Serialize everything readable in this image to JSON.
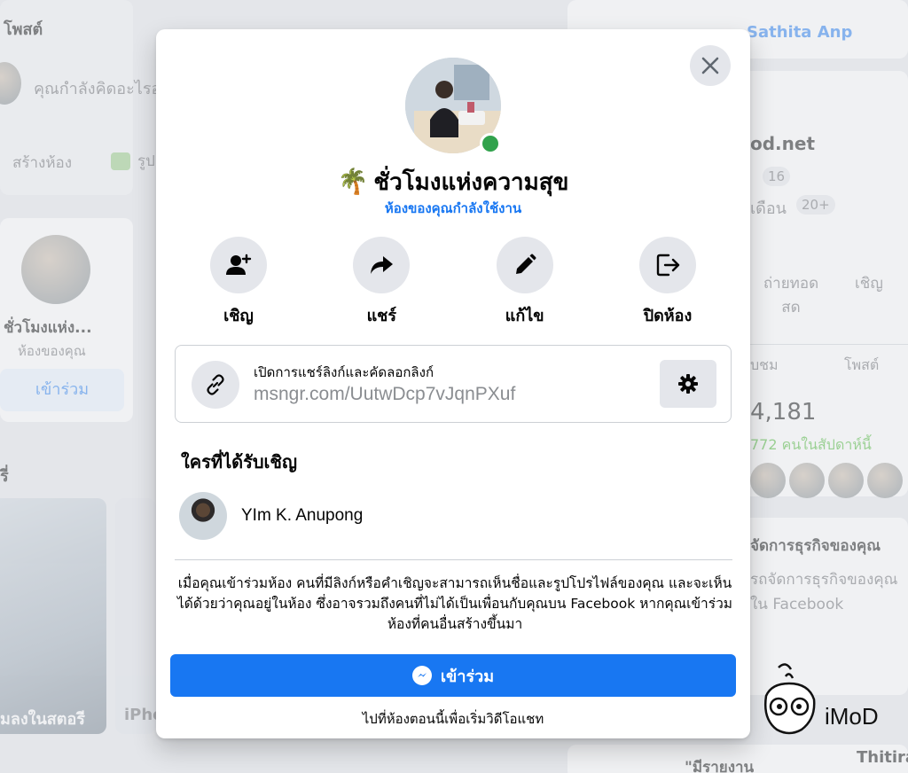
{
  "background": {
    "left_title": "โพสต์",
    "composer_placeholder": "คุณกำลังคิดอะไรอยู่",
    "create_room": "สร้างห้อง",
    "photo_chip": "รูป",
    "room_card_title": "ชั่วโมงแห่ง...",
    "room_card_sub": "ห้องของคุณ",
    "room_card_join": "เข้าร่วม",
    "stories_title": "รี่",
    "story_caption": "มลงในสตอรี",
    "story_caption2": "iPho",
    "right_header": "Sathita Anp",
    "site_name": "od.net",
    "count_chip_1": "16",
    "month_label": "เดือน",
    "count_chip_2": "20+",
    "live_label": "ถ่ายทอดสด",
    "invite_label_bg": "เชิญ",
    "tab_likes": "บชม",
    "tab_posts": "โพสต์",
    "likes_count": "4,181",
    "likes_week": "772 คนในสัปดาห์นี้",
    "promo_title": "จัดการธุรกิจของคุณ",
    "promo_text": "รถจัดการธุรกิจของคุณใน Facebook",
    "bottom_quote": "\"มีรายงาน",
    "bottom_name": "Thitira"
  },
  "modal": {
    "room_emoji": "🌴",
    "room_title": "ชั่วโมงแห่งความสุข",
    "room_subtitle": "ห้องของคุณกำลังใช้งาน",
    "actions": [
      {
        "label": "เชิญ",
        "icon": "add-person-icon"
      },
      {
        "label": "แชร์",
        "icon": "share-arrow-icon"
      },
      {
        "label": "แก้ไข",
        "icon": "pencil-icon"
      },
      {
        "label": "ปิดห้อง",
        "icon": "exit-icon"
      }
    ],
    "link_label": "เปิดการแชร์ลิงก์และคัดลอกลิงก์",
    "link_url": "msngr.com/UutwDcp7vJqnPXuf",
    "invited_title": "ใครที่ได้รับเชิญ",
    "invitees": [
      {
        "name": "YIm K. Anupong"
      }
    ],
    "notice": "เมื่อคุณเข้าร่วมห้อง คนที่มีลิงก์หรือคำเชิญจะสามารถเห็นชื่อและรูปโปรไฟล์ของคุณ และจะเห็นได้ด้วยว่าคุณอยู่ในห้อง ซึ่งอาจรวมถึงคนที่ไม่ได้เป็นเพื่อนกับคุณบน Facebook หากคุณเข้าร่วมห้องที่คนอื่นสร้างขึ้นมา",
    "join_label": "เข้าร่วม",
    "footer": "ไปที่ห้องตอนนี้เพื่อเริ่มวิดีโอแชท"
  },
  "watermark": {
    "text": "iMoD"
  },
  "colors": {
    "brand_blue": "#1877f2",
    "online_green": "#31a24c",
    "button_grey": "#e4e6eb"
  }
}
